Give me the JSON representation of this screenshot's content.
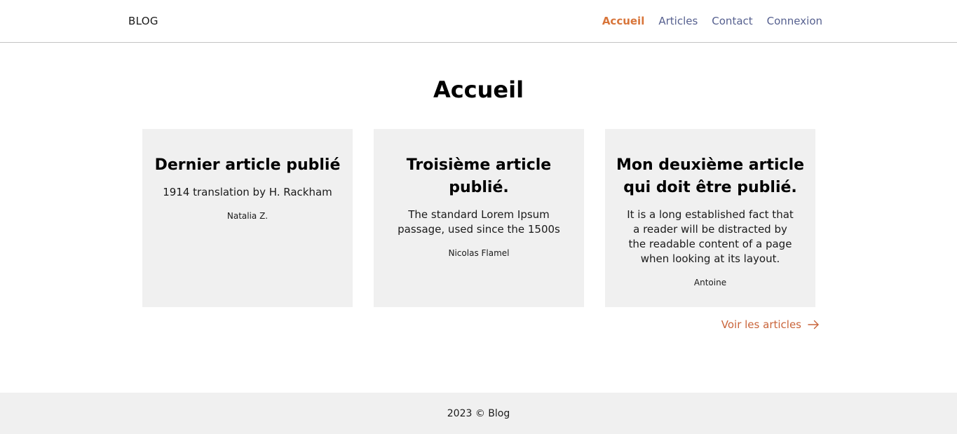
{
  "header": {
    "brand": "BLOG",
    "nav": [
      {
        "label": "Accueil",
        "active": true
      },
      {
        "label": "Articles",
        "active": false
      },
      {
        "label": "Contact",
        "active": false
      },
      {
        "label": "Connexion",
        "active": false
      }
    ]
  },
  "main": {
    "title": "Accueil",
    "cards": [
      {
        "title": "Dernier article publié",
        "excerpt": "1914 translation by H. Rackham",
        "author": "Natalia Z."
      },
      {
        "title": "Troisième article publié.",
        "excerpt": "The standard Lorem Ipsum passage, used since the 1500s",
        "author": "Nicolas Flamel"
      },
      {
        "title": "Mon deuxième article qui doit être publié.",
        "excerpt": "It is a long established fact that a reader will be distracted by the readable content of a page when looking at its layout.",
        "author": "Antoine"
      }
    ],
    "more_link": {
      "label": "Voir les articles",
      "icon": "arrow-right-icon"
    }
  },
  "footer": {
    "text": "2023 © Blog"
  },
  "colors": {
    "accent": "#d8753a",
    "nav_link": "#56608f",
    "card_bg": "#f0f0f0",
    "footer_bg": "#f0f0f0"
  }
}
